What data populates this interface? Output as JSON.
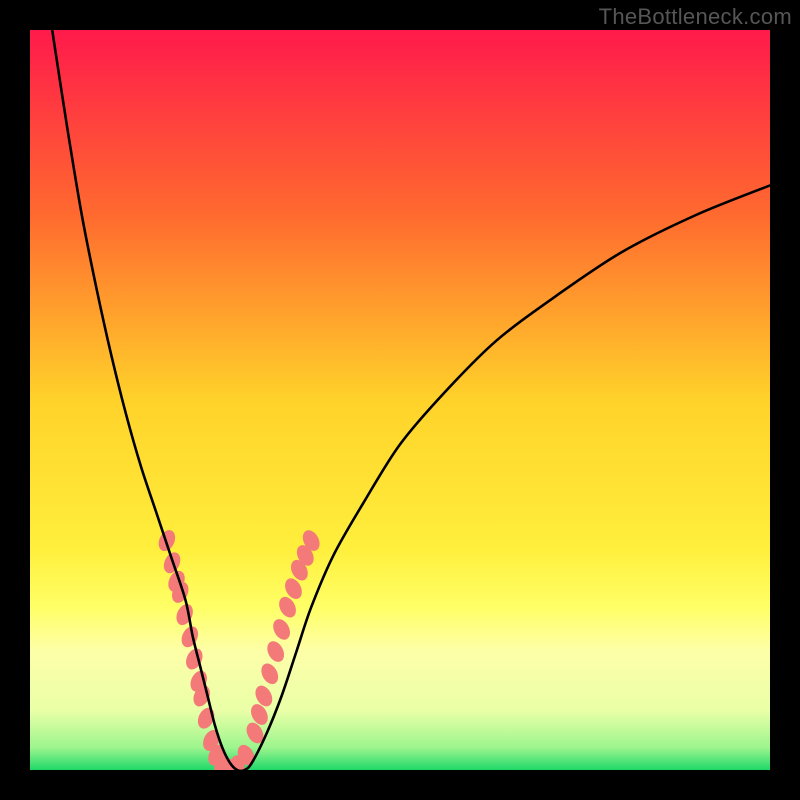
{
  "watermark": "TheBottleneck.com",
  "chart_data": {
    "type": "line",
    "title": "",
    "xlabel": "",
    "ylabel": "",
    "xlim": [
      0,
      100
    ],
    "ylim": [
      0,
      100
    ],
    "gradient_stops": [
      {
        "pct": 0,
        "color": "#ff1a4b"
      },
      {
        "pct": 25,
        "color": "#ff6a2f"
      },
      {
        "pct": 50,
        "color": "#ffd22a"
      },
      {
        "pct": 70,
        "color": "#ffef3c"
      },
      {
        "pct": 78,
        "color": "#ffff66"
      },
      {
        "pct": 84,
        "color": "#fdffa8"
      },
      {
        "pct": 92,
        "color": "#e9ffa7"
      },
      {
        "pct": 97,
        "color": "#9cf58d"
      },
      {
        "pct": 100,
        "color": "#1fd86a"
      }
    ],
    "series": [
      {
        "name": "curve",
        "x": [
          3,
          5,
          7,
          9,
          11,
          13,
          15,
          17,
          19,
          21,
          22,
          23,
          24,
          25,
          26,
          27,
          28,
          29,
          30,
          32,
          34,
          36,
          38,
          41,
          45,
          50,
          56,
          63,
          71,
          80,
          90,
          100
        ],
        "y_pct": [
          0,
          13,
          25,
          35,
          44,
          52,
          59,
          65,
          71,
          77,
          82,
          86,
          90,
          94,
          97,
          99,
          100,
          100,
          99,
          95,
          90,
          84,
          78,
          71,
          64,
          56,
          49,
          42,
          36,
          30,
          25,
          21
        ]
      }
    ],
    "markers": [
      {
        "name": "cluster",
        "color": "#f47a7a",
        "points_xy_pct": [
          [
            18.5,
            69
          ],
          [
            19.2,
            72
          ],
          [
            19.8,
            74.5
          ],
          [
            20.3,
            76
          ],
          [
            20.9,
            79
          ],
          [
            21.6,
            82
          ],
          [
            22.2,
            85
          ],
          [
            22.8,
            88
          ],
          [
            23.2,
            90
          ],
          [
            23.8,
            93
          ],
          [
            24.5,
            96
          ],
          [
            25.2,
            98
          ],
          [
            26.0,
            99.5
          ],
          [
            27.0,
            100
          ],
          [
            28.0,
            99.5
          ],
          [
            29.2,
            98
          ],
          [
            30.4,
            95
          ],
          [
            31.0,
            92.5
          ],
          [
            31.6,
            90
          ],
          [
            32.4,
            87
          ],
          [
            33.2,
            84
          ],
          [
            34.0,
            81
          ],
          [
            34.8,
            78
          ],
          [
            35.6,
            75.5
          ],
          [
            36.4,
            73
          ],
          [
            37.2,
            71
          ],
          [
            38.0,
            69
          ]
        ]
      }
    ]
  }
}
